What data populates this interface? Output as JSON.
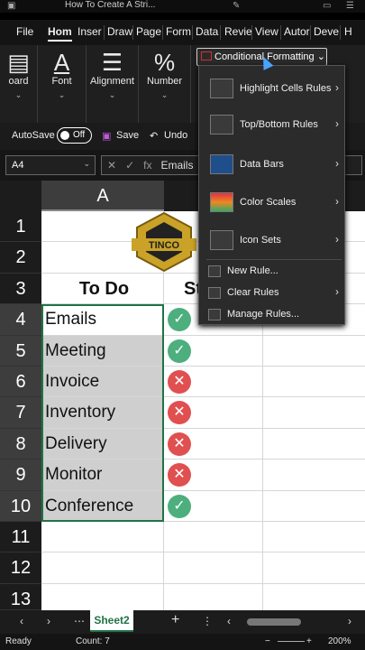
{
  "window": {
    "title": "How To Create A Stri..."
  },
  "tabs": [
    {
      "label": "File"
    },
    {
      "label": "Hom"
    },
    {
      "label": "Inser"
    },
    {
      "label": "Draw"
    },
    {
      "label": "Page"
    },
    {
      "label": "Form"
    },
    {
      "label": "Data"
    },
    {
      "label": "Revie"
    },
    {
      "label": "View"
    },
    {
      "label": "Autor"
    },
    {
      "label": "Deve"
    },
    {
      "label": "H"
    }
  ],
  "ribbon": {
    "clipboard_label": "oard",
    "font_label": "Font",
    "alignment_label": "Alignment",
    "number_label": "Number",
    "cond_format_label": "Conditional Formatting"
  },
  "qat": {
    "autosave_label": "AutoSave",
    "autosave_state": "Off",
    "save_label": "Save",
    "undo_label": "Undo"
  },
  "formula_bar": {
    "name_box": "A4",
    "content": "Emails",
    "fx": "fx"
  },
  "grid": {
    "column_a": "A",
    "row_numbers": [
      "1",
      "2",
      "3",
      "4",
      "5",
      "6",
      "7",
      "8",
      "9",
      "10",
      "11",
      "12",
      "13"
    ],
    "header": "To Do",
    "header_b": "St",
    "tasks": [
      {
        "name": "Emails",
        "status": "ok"
      },
      {
        "name": "Meeting",
        "status": "ok"
      },
      {
        "name": "Invoice",
        "status": "bad"
      },
      {
        "name": "Inventory",
        "status": "bad"
      },
      {
        "name": "Delivery",
        "status": "bad"
      },
      {
        "name": "Monitor",
        "status": "bad"
      },
      {
        "name": "Conference",
        "status": "ok"
      }
    ],
    "logo_text": "TINCO"
  },
  "menu": {
    "highlight": "Highlight Cells Rules",
    "topbottom": "Top/Bottom Rules",
    "databars": "Data Bars",
    "colorscales": "Color Scales",
    "iconsets": "Icon Sets",
    "newrule": "New Rule...",
    "clearrules": "Clear Rules",
    "managerules": "Manage Rules..."
  },
  "sheets": {
    "active": "Sheet2"
  },
  "status": {
    "mode": "Ready",
    "count": "Count: 7",
    "zoom": "200%"
  },
  "colors": {
    "ok": "#4caf7d",
    "bad": "#e05050",
    "excel_green": "#217346"
  }
}
